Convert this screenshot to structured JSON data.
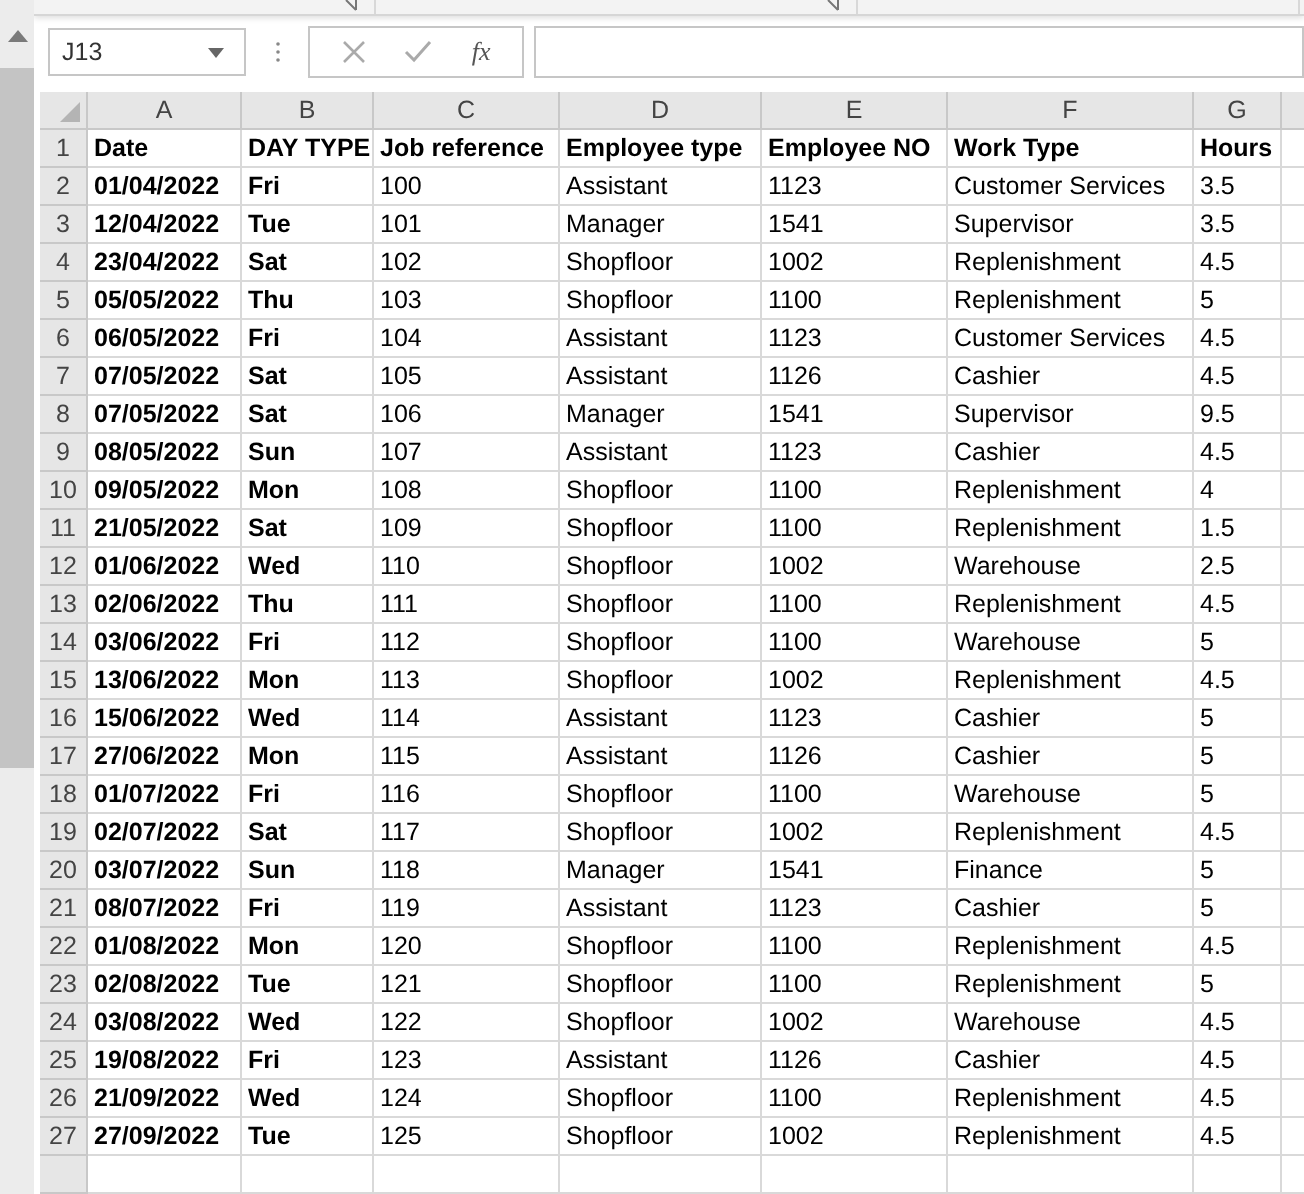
{
  "name_box": {
    "value": "J13"
  },
  "formula_bar": {
    "function_label": "fx"
  },
  "columns": [
    {
      "letter": "A",
      "bold": true
    },
    {
      "letter": "B",
      "bold": true
    },
    {
      "letter": "C",
      "bold": false
    },
    {
      "letter": "D",
      "bold": false
    },
    {
      "letter": "E",
      "bold": false
    },
    {
      "letter": "F",
      "bold": false
    },
    {
      "letter": "G",
      "bold": false
    }
  ],
  "header_row": {
    "number": "1",
    "cells": [
      "Date",
      "DAY TYPE",
      "Job reference",
      "Employee type",
      "Employee NO",
      "Work Type",
      "Hours"
    ]
  },
  "rows": [
    {
      "number": "2",
      "cells": [
        "01/04/2022",
        "Fri",
        "100",
        "Assistant",
        "1123",
        "Customer Services",
        "3.5"
      ]
    },
    {
      "number": "3",
      "cells": [
        "12/04/2022",
        "Tue",
        "101",
        "Manager",
        "1541",
        "Supervisor",
        "3.5"
      ]
    },
    {
      "number": "4",
      "cells": [
        "23/04/2022",
        "Sat",
        "102",
        "Shopfloor",
        "1002",
        "Replenishment",
        "4.5"
      ]
    },
    {
      "number": "5",
      "cells": [
        "05/05/2022",
        "Thu",
        "103",
        "Shopfloor",
        "1100",
        "Replenishment",
        "5"
      ]
    },
    {
      "number": "6",
      "cells": [
        "06/05/2022",
        "Fri",
        "104",
        "Assistant",
        "1123",
        "Customer Services",
        "4.5"
      ]
    },
    {
      "number": "7",
      "cells": [
        "07/05/2022",
        "Sat",
        "105",
        "Assistant",
        "1126",
        "Cashier",
        "4.5"
      ]
    },
    {
      "number": "8",
      "cells": [
        "07/05/2022",
        "Sat",
        "106",
        "Manager",
        "1541",
        "Supervisor",
        "9.5"
      ]
    },
    {
      "number": "9",
      "cells": [
        "08/05/2022",
        "Sun",
        "107",
        "Assistant",
        "1123",
        "Cashier",
        "4.5"
      ]
    },
    {
      "number": "10",
      "cells": [
        "09/05/2022",
        "Mon",
        "108",
        "Shopfloor",
        "1100",
        "Replenishment",
        "4"
      ]
    },
    {
      "number": "11",
      "cells": [
        "21/05/2022",
        "Sat",
        "109",
        "Shopfloor",
        "1100",
        "Replenishment",
        "1.5"
      ]
    },
    {
      "number": "12",
      "cells": [
        "01/06/2022",
        "Wed",
        "110",
        "Shopfloor",
        "1002",
        "Warehouse",
        "2.5"
      ]
    },
    {
      "number": "13",
      "cells": [
        "02/06/2022",
        "Thu",
        "111",
        "Shopfloor",
        "1100",
        "Replenishment",
        "4.5"
      ]
    },
    {
      "number": "14",
      "cells": [
        "03/06/2022",
        "Fri",
        "112",
        "Shopfloor",
        "1100",
        "Warehouse",
        "5"
      ]
    },
    {
      "number": "15",
      "cells": [
        "13/06/2022",
        "Mon",
        "113",
        "Shopfloor",
        "1002",
        "Replenishment",
        "4.5"
      ]
    },
    {
      "number": "16",
      "cells": [
        "15/06/2022",
        "Wed",
        "114",
        "Assistant",
        "1123",
        "Cashier",
        "5"
      ]
    },
    {
      "number": "17",
      "cells": [
        "27/06/2022",
        "Mon",
        "115",
        "Assistant",
        "1126",
        "Cashier",
        "5"
      ]
    },
    {
      "number": "18",
      "cells": [
        "01/07/2022",
        "Fri",
        "116",
        "Shopfloor",
        "1100",
        "Warehouse",
        "5"
      ]
    },
    {
      "number": "19",
      "cells": [
        "02/07/2022",
        "Sat",
        "117",
        "Shopfloor",
        "1002",
        "Replenishment",
        "4.5"
      ]
    },
    {
      "number": "20",
      "cells": [
        "03/07/2022",
        "Sun",
        "118",
        "Manager",
        "1541",
        "Finance",
        "5"
      ]
    },
    {
      "number": "21",
      "cells": [
        "08/07/2022",
        "Fri",
        "119",
        "Assistant",
        "1123",
        "Cashier",
        "5"
      ]
    },
    {
      "number": "22",
      "cells": [
        "01/08/2022",
        "Mon",
        "120",
        "Shopfloor",
        "1100",
        "Replenishment",
        "4.5"
      ]
    },
    {
      "number": "23",
      "cells": [
        "02/08/2022",
        "Tue",
        "121",
        "Shopfloor",
        "1100",
        "Replenishment",
        "5"
      ]
    },
    {
      "number": "24",
      "cells": [
        "03/08/2022",
        "Wed",
        "122",
        "Shopfloor",
        "1002",
        "Warehouse",
        "4.5"
      ]
    },
    {
      "number": "25",
      "cells": [
        "19/08/2022",
        "Fri",
        "123",
        "Assistant",
        "1126",
        "Cashier",
        "4.5"
      ]
    },
    {
      "number": "26",
      "cells": [
        "21/09/2022",
        "Wed",
        "124",
        "Shopfloor",
        "1100",
        "Replenishment",
        "4.5"
      ]
    },
    {
      "number": "27",
      "cells": [
        "27/09/2022",
        "Tue",
        "125",
        "Shopfloor",
        "1002",
        "Replenishment",
        "4.5"
      ]
    }
  ]
}
